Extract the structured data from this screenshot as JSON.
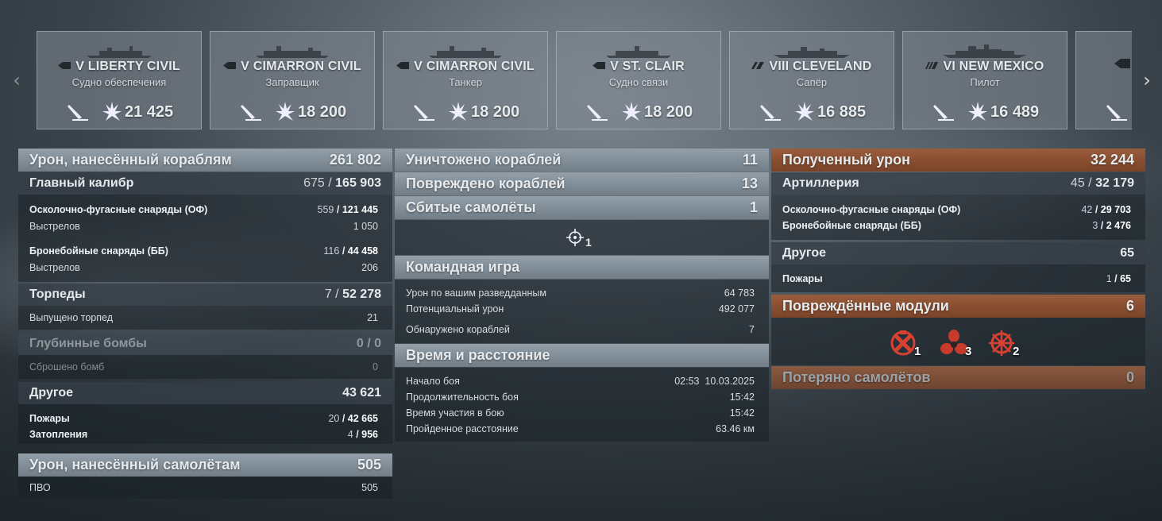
{
  "carousel": {
    "prev": "‹",
    "next": "›",
    "cards": [
      {
        "class": "auxiliary",
        "tier": "V",
        "name": "LIBERTY CIVIL",
        "role": "Судно обеспечения",
        "damage": "21 425"
      },
      {
        "class": "auxiliary",
        "tier": "V",
        "name": "CIMARRON CIVIL",
        "role": "Заправщик",
        "damage": "18 200"
      },
      {
        "class": "auxiliary",
        "tier": "V",
        "name": "CIMARRON CIVIL",
        "role": "Танкер",
        "damage": "18 200"
      },
      {
        "class": "auxiliary",
        "tier": "V",
        "name": "ST. CLAIR",
        "role": "Судно связи",
        "damage": "18 200"
      },
      {
        "class": "cruiser",
        "tier": "VIII",
        "name": "CLEVELAND",
        "role": "Сапёр",
        "damage": "16 885"
      },
      {
        "class": "battleship",
        "tier": "VI",
        "name": "NEW MEXICO",
        "role": "Пилот",
        "damage": "16 489"
      }
    ]
  },
  "left": {
    "ships_damage": {
      "label": "Урон, нанесённый кораблям",
      "value": "261 802"
    },
    "main_battery": {
      "label": "Главный калибр",
      "hits": "675",
      "sep": "/",
      "value": "165 903"
    },
    "he": {
      "label": "Осколочно-фугасные снаряды (ОФ)",
      "hits": "559",
      "value": "121 445"
    },
    "he_shots": {
      "label": "Выстрелов",
      "value": "1 050"
    },
    "ap": {
      "label": "Бронебойные снаряды (ББ)",
      "hits": "116",
      "value": "44 458"
    },
    "ap_shots": {
      "label": "Выстрелов",
      "value": "206"
    },
    "torpedoes": {
      "label": "Торпеды",
      "hits": "7",
      "value": "52 278"
    },
    "torp_launched": {
      "label": "Выпущено торпед",
      "value": "21"
    },
    "depth": {
      "label": "Глубинные бомбы",
      "value": "0 / 0"
    },
    "depth_dropped": {
      "label": "Сброшено бомб",
      "value": "0"
    },
    "other": {
      "label": "Другое",
      "value": "43 621"
    },
    "fires": {
      "label": "Пожары",
      "hits": "20",
      "value": "42 665"
    },
    "floods": {
      "label": "Затопления",
      "hits": "4",
      "value": "956"
    },
    "planes_damage": {
      "label": "Урон, нанесённый самолётам",
      "value": "505"
    },
    "aa": {
      "label": "ПВО",
      "value": "505"
    }
  },
  "middle": {
    "destroyed": {
      "label": "Уничтожено кораблей",
      "value": "11"
    },
    "damaged": {
      "label": "Повреждено кораблей",
      "value": "13"
    },
    "shot_down": {
      "label": "Сбитые самолёты",
      "value": "1"
    },
    "shot_down_icon_count": "1",
    "team": {
      "label": "Командная игра"
    },
    "spotting_damage": {
      "label": "Урон по вашим разведданным",
      "value": "64 783"
    },
    "potential": {
      "label": "Потенциальный урон",
      "value": "492 077"
    },
    "spotted": {
      "label": "Обнаружено кораблей",
      "value": "7"
    },
    "time": {
      "label": "Время и расстояние"
    },
    "start": {
      "label": "Начало боя",
      "value": "02:53  10.03.2025"
    },
    "duration": {
      "label": "Продолжительность боя",
      "value": "15:42"
    },
    "participation": {
      "label": "Время участия в бою",
      "value": "15:42"
    },
    "distance": {
      "label": "Пройденное расстояние",
      "value": "63.46 км"
    }
  },
  "right": {
    "received": {
      "label": "Полученный урон",
      "value": "32 244"
    },
    "artillery": {
      "label": "Артиллерия",
      "hits": "45",
      "value": "32 179"
    },
    "he": {
      "label": "Осколочно-фугасные снаряды (ОФ)",
      "hits": "42",
      "value": "29 703"
    },
    "ap": {
      "label": "Бронебойные снаряды (ББ)",
      "hits": "3",
      "value": "2 476"
    },
    "other": {
      "label": "Другое",
      "value": "65"
    },
    "fires": {
      "label": "Пожары",
      "hits": "1",
      "value": "65"
    },
    "modules": {
      "label": "Повреждённые модули",
      "value": "6"
    },
    "module_items": [
      {
        "icon": "engine-icon",
        "count": "1"
      },
      {
        "icon": "propeller-icon",
        "count": "3"
      },
      {
        "icon": "steering-gear-icon",
        "count": "2"
      }
    ],
    "planes_lost": {
      "label": "Потеряно самолётов",
      "value": "0"
    }
  },
  "colors": {
    "header_blue": "#8a96a0",
    "header_orange": "#8f5236"
  }
}
